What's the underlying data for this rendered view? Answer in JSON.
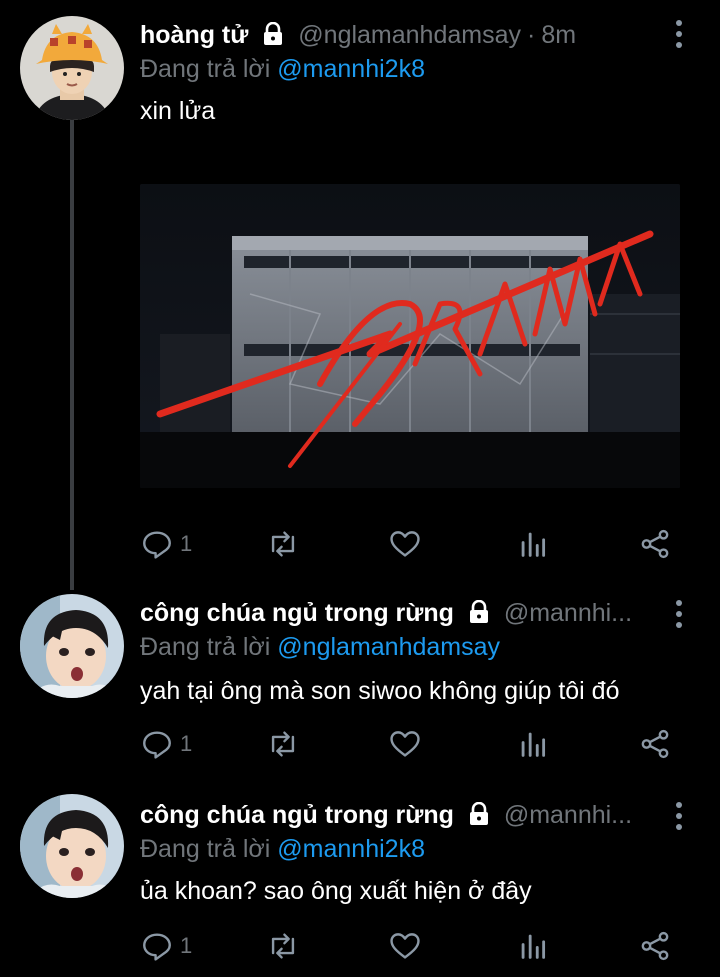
{
  "tweets": [
    {
      "display_name": "hoàng tử",
      "handle": "@nglamanhdamsay",
      "separator": "·",
      "time": "8m",
      "replying_to_prefix": "Đang trả lời",
      "replying_to": "@mannhi2k8",
      "text": "xin lửa",
      "media_text": "DRAMA",
      "reply_count": "1",
      "retweet_count": "",
      "like_count": ""
    },
    {
      "display_name": "công chúa ngủ trong rừng",
      "handle": "@mannhi...",
      "replying_to_prefix": "Đang trả lời",
      "replying_to": "@nglamanhdamsay",
      "text": "yah tại ông mà son siwoo không giúp tôi đó",
      "reply_count": "1"
    },
    {
      "display_name": "công chúa ngủ trong rừng",
      "handle": "@mannhi...",
      "replying_to_prefix": "Đang trả lời",
      "replying_to": "@mannhi2k8",
      "text": "ủa khoan? sao ông xuất hiện ở đây",
      "reply_count": "1"
    }
  ],
  "icons": {
    "reply": "reply-icon",
    "retweet": "retweet-icon",
    "like": "heart-icon",
    "analytics": "analytics-icon",
    "share": "share-icon",
    "lock": "lock-icon",
    "more": "more-vertical-icon"
  },
  "colors": {
    "background": "#000000",
    "text": "#ffffff",
    "muted": "#71767b",
    "mention": "#1d9bf0",
    "thread_line": "#3a3d41",
    "drama_red": "#e02a1e"
  }
}
